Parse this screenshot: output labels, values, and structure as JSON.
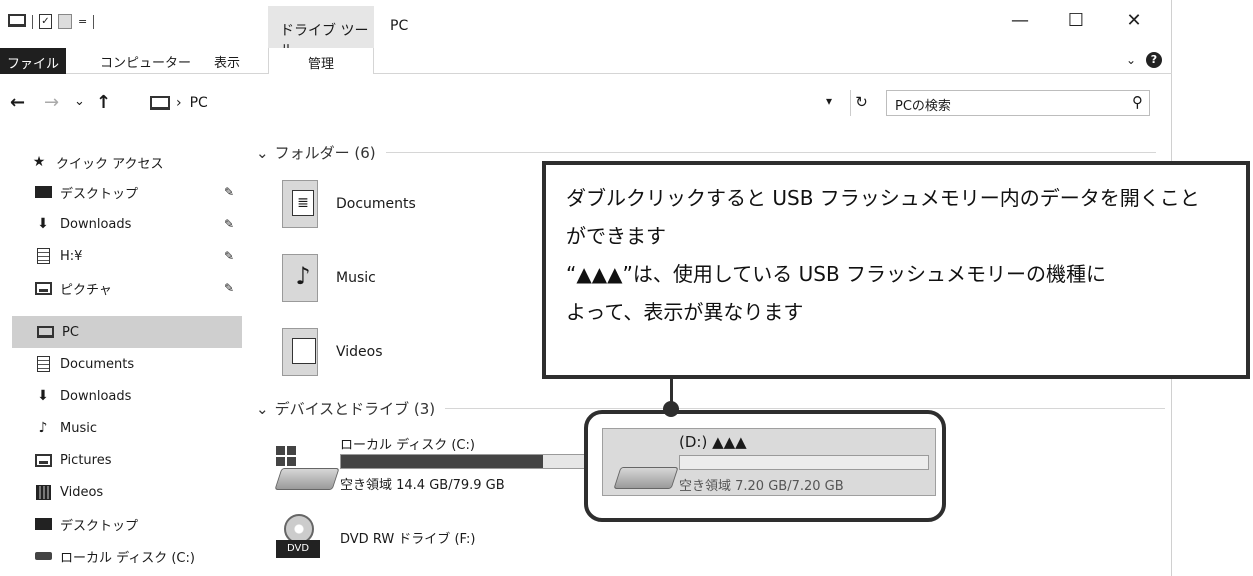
{
  "titlebar": {
    "drive_tools_tab": "ドライブ ツール",
    "window_title": "PC",
    "minimize": "—",
    "maximize": "☐",
    "close": "✕"
  },
  "ribbon": {
    "tabs": [
      "ファイル",
      "コンピューター",
      "表示",
      "管理"
    ]
  },
  "navbar": {
    "back": "←",
    "forward": "→",
    "recent": "⌄",
    "up": "↑",
    "address_sep": "›",
    "address": "PC",
    "search_placeholder": "PCの検索"
  },
  "sidebar": {
    "quick_access": "クイック アクセス",
    "pinned": [
      {
        "label": "デスクトップ",
        "icon": "desktop-icon"
      },
      {
        "label": "Downloads",
        "icon": "download-arrow-icon"
      },
      {
        "label": "H:¥",
        "icon": "document-icon"
      },
      {
        "label": "ピクチャ",
        "icon": "pictures-icon"
      }
    ],
    "pc": "PC",
    "pc_children": [
      {
        "label": "Documents",
        "icon": "document-icon"
      },
      {
        "label": "Downloads",
        "icon": "download-arrow-icon"
      },
      {
        "label": "Music",
        "icon": "music-note-icon"
      },
      {
        "label": "Pictures",
        "icon": "pictures-icon"
      },
      {
        "label": "Videos",
        "icon": "film-icon"
      },
      {
        "label": "デスクトップ",
        "icon": "desktop-icon"
      },
      {
        "label": "ローカル ディスク (C:)",
        "icon": "drive-icon"
      }
    ]
  },
  "content": {
    "folders_header": "フォルダー (6)",
    "folders": [
      "Documents",
      "Music",
      "Videos"
    ],
    "devices_header": "デバイスとドライブ (3)",
    "drive_c": {
      "name": "ローカル ディスク (C:)",
      "free": "空き領域 14.4 GB/79.9 GB",
      "used_fraction": 0.82
    },
    "drive_d": {
      "name": "(D:) ▲▲▲",
      "free": "空き領域 7.20 GB/7.20 GB",
      "used_fraction": 0
    },
    "drive_f": {
      "name": "DVD RW ドライブ (F:)",
      "dvd_label": "DVD"
    }
  },
  "callout": {
    "lines": [
      "ダブルクリックすると USB フラッシュメモリー内のデータを開くこと",
      "ができます",
      "“▲▲▲”は、使用している USB フラッシュメモリーの機種に",
      "よって、表示が異なります"
    ]
  }
}
